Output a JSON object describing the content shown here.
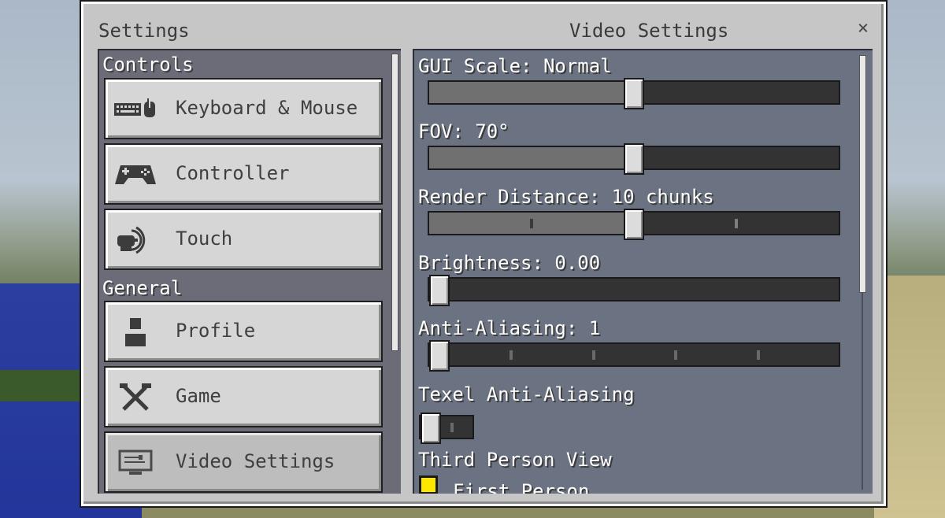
{
  "window": {
    "title": "Settings",
    "page_title": "Video Settings",
    "close_icon": "×"
  },
  "sidebar": {
    "sections": [
      {
        "label": "Controls",
        "items": [
          {
            "label": "Keyboard & Mouse",
            "icon": "keyboard-mouse-icon"
          },
          {
            "label": "Controller",
            "icon": "gamepad-icon"
          },
          {
            "label": "Touch",
            "icon": "touch-icon"
          }
        ]
      },
      {
        "label": "General",
        "items": [
          {
            "label": "Profile",
            "icon": "profile-icon"
          },
          {
            "label": "Game",
            "icon": "tools-icon"
          },
          {
            "label": "Video Settings",
            "icon": "monitor-icon",
            "active": true
          }
        ]
      }
    ]
  },
  "options": {
    "gui_scale": {
      "label": "GUI Scale: Normal",
      "value_fraction": 0.5
    },
    "fov": {
      "label": "FOV: 70°",
      "value_fraction": 0.5
    },
    "render_distance": {
      "label": "Render Distance: 10 chunks",
      "value_fraction": 0.5
    },
    "brightness": {
      "label": "Brightness: 0.00",
      "value_fraction": 0.0
    },
    "anti_aliasing": {
      "label": "Anti-Aliasing: 1",
      "value_fraction": 0.0
    },
    "texel_anti_aliasing": {
      "label": "Texel Anti-Aliasing",
      "enabled": false
    },
    "third_person_view": {
      "label": "Third Person View",
      "option_label": "First Person",
      "checked": true
    }
  },
  "colors": {
    "checkbox": "#ffe600",
    "content_bg": "#6b7282",
    "sidebar_bg": "#6c6c78"
  }
}
